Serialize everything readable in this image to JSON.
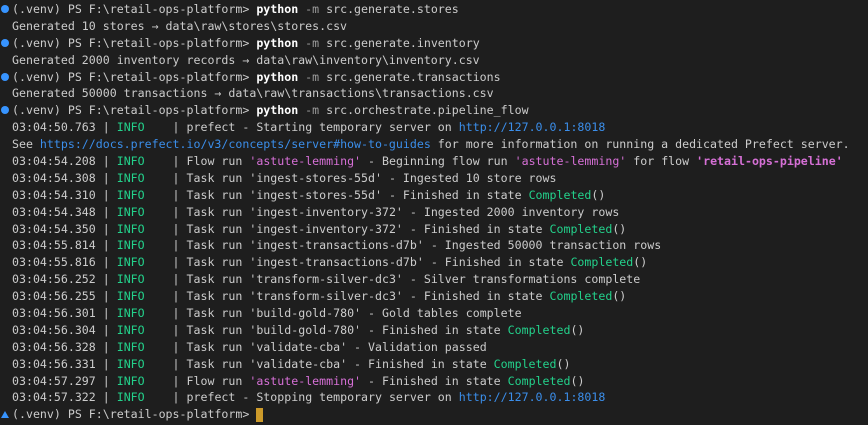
{
  "colors": {
    "background": "#1e1e1e",
    "text": "#cccccc",
    "prompt_dot": "#3794ff",
    "info": "#23d18b",
    "url": "#3b8eea",
    "flow_name": "#d670d6",
    "completed": "#23d18b",
    "cursor": "#cc9a2a"
  },
  "prompt": "(.venv) PS F:\\retail-ops-platform> ",
  "commands": [
    {
      "cmd": "python",
      "flag": "-m",
      "arg": "src.generate.stores",
      "output": "Generated 10 stores → data\\raw\\stores\\stores.csv"
    },
    {
      "cmd": "python",
      "flag": "-m",
      "arg": "src.generate.inventory",
      "output": "Generated 2000 inventory records → data\\raw\\inventory\\inventory.csv"
    },
    {
      "cmd": "python",
      "flag": "-m",
      "arg": "src.generate.transactions",
      "output": "Generated 50000 transactions → data\\raw\\transactions\\transactions.csv"
    },
    {
      "cmd": "python",
      "flag": "-m",
      "arg": "src.orchestrate.pipeline_flow"
    }
  ],
  "pipeline_log": {
    "server_start": {
      "ts": "03:04:50.763",
      "level": "INFO",
      "prefix": "prefect - Starting temporary server on ",
      "url": "http://127.0.0.1:8018"
    },
    "see_line": {
      "prefix": "See ",
      "url": "https://docs.prefect.io/v3/concepts/server#how-to-guides",
      "suffix": " for more information on running a dedicated Prefect server."
    },
    "flow_begin": {
      "ts": "03:04:54.208",
      "level": "INFO",
      "a": "Flow run ",
      "name": "'astute-lemming'",
      "b": " - Beginning flow run ",
      "name2": "'astute-lemming'",
      "c": " for flow ",
      "flow": "'retail-ops-pipeline'"
    },
    "tasks": [
      {
        "ts": "03:04:54.308",
        "level": "INFO",
        "text": "Task run 'ingest-stores-55d' - Ingested 10 store rows",
        "completed": false
      },
      {
        "ts": "03:04:54.310",
        "level": "INFO",
        "text": "Task run 'ingest-stores-55d' - Finished in state ",
        "completed": true
      },
      {
        "ts": "03:04:54.348",
        "level": "INFO",
        "text": "Task run 'ingest-inventory-372' - Ingested 2000 inventory rows",
        "completed": false
      },
      {
        "ts": "03:04:54.350",
        "level": "INFO",
        "text": "Task run 'ingest-inventory-372' - Finished in state ",
        "completed": true
      },
      {
        "ts": "03:04:55.814",
        "level": "INFO",
        "text": "Task run 'ingest-transactions-d7b' - Ingested 50000 transaction rows",
        "completed": false
      },
      {
        "ts": "03:04:55.816",
        "level": "INFO",
        "text": "Task run 'ingest-transactions-d7b' - Finished in state ",
        "completed": true
      },
      {
        "ts": "03:04:56.252",
        "level": "INFO",
        "text": "Task run 'transform-silver-dc3' - Silver transformations complete",
        "completed": false
      },
      {
        "ts": "03:04:56.255",
        "level": "INFO",
        "text": "Task run 'transform-silver-dc3' - Finished in state ",
        "completed": true
      },
      {
        "ts": "03:04:56.301",
        "level": "INFO",
        "text": "Task run 'build-gold-780' - Gold tables complete",
        "completed": false
      },
      {
        "ts": "03:04:56.304",
        "level": "INFO",
        "text": "Task run 'build-gold-780' - Finished in state ",
        "completed": true
      },
      {
        "ts": "03:04:56.328",
        "level": "INFO",
        "text": "Task run 'validate-cba' - Validation passed",
        "completed": false
      },
      {
        "ts": "03:04:56.331",
        "level": "INFO",
        "text": "Task run 'validate-cba' - Finished in state ",
        "completed": true
      }
    ],
    "completed_label": "Completed",
    "completed_suffix": "()",
    "flow_end": {
      "ts": "03:04:57.297",
      "level": "INFO",
      "a": "Flow run ",
      "name": "'astute-lemming'",
      "b": " - Finished in state ",
      "state": "Completed",
      "suffix": "()"
    },
    "server_stop": {
      "ts": "03:04:57.322",
      "level": "INFO",
      "prefix": "prefect - Stopping temporary server on ",
      "url": "http://127.0.0.1:8018"
    }
  }
}
